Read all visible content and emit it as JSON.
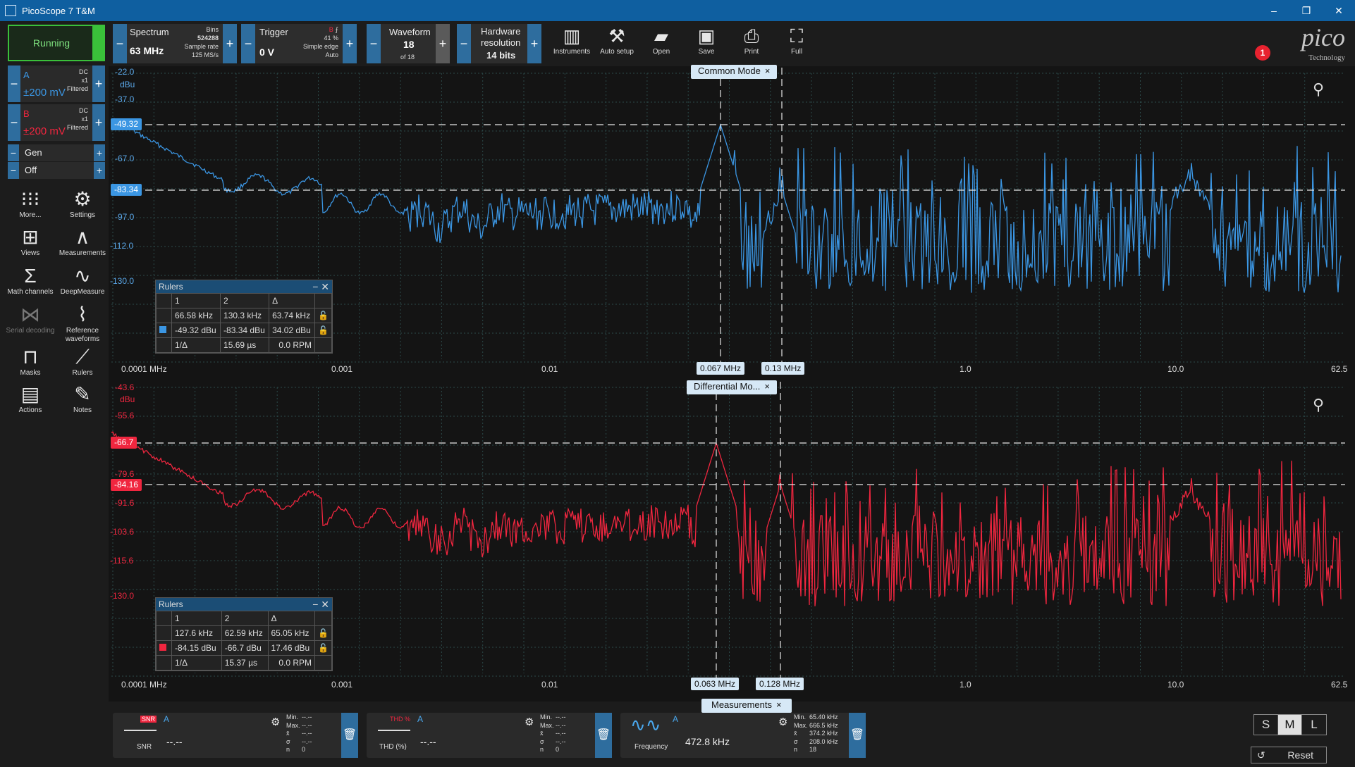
{
  "window": {
    "title": "PicoScope 7 T&M",
    "minimize": "–",
    "maximize": "❐",
    "close": "✕"
  },
  "toolbar": {
    "spectrum": {
      "label": "Spectrum",
      "value": "63 MHz",
      "bins_label": "Bins",
      "bins": "524288",
      "rate_label": "Sample rate",
      "rate": "125 MS/s"
    },
    "trigger": {
      "label": "Trigger",
      "value": "0 V",
      "channel": "B",
      "percent": "41 %",
      "type": "Simple edge",
      "mode": "Auto"
    },
    "waveform": {
      "label": "Waveform",
      "value": "18",
      "of": "of 18"
    },
    "hardware": {
      "label1": "Hardware",
      "label2": "resolution",
      "value": "14 bits"
    },
    "buttons": [
      {
        "label": "Instruments",
        "icon": "instruments-icon"
      },
      {
        "label": "Auto setup",
        "icon": "auto-setup-icon"
      },
      {
        "label": "Open",
        "icon": "folder-icon"
      },
      {
        "label": "Save",
        "icon": "save-icon"
      },
      {
        "label": "Print",
        "icon": "print-icon"
      },
      {
        "label": "Full",
        "icon": "fullscreen-icon"
      }
    ],
    "logo_text": "pico",
    "logo_sub": "Technology",
    "notification_count": "1"
  },
  "sidebar": {
    "run_state": "Running",
    "channel_a": {
      "name": "A",
      "range": "±200 mV",
      "coupling": "DC",
      "probe": "x1",
      "filter": "Filtered",
      "color": "#3b96e3"
    },
    "channel_b": {
      "name": "B",
      "range": "±200 mV",
      "coupling": "DC",
      "probe": "x1",
      "filter": "Filtered",
      "color": "#f0263f"
    },
    "gen": "Gen",
    "gen_state": "Off",
    "tools": [
      {
        "label": "More...",
        "icon": "more-icon"
      },
      {
        "label": "Settings",
        "icon": "gear-icon"
      },
      {
        "label": "Views",
        "icon": "views-icon"
      },
      {
        "label": "Measurements",
        "icon": "measurements-icon"
      },
      {
        "label": "Math channels",
        "icon": "sigma-icon"
      },
      {
        "label": "DeepMeasure",
        "icon": "deepmeasure-icon"
      },
      {
        "label": "Serial decoding",
        "icon": "serial-decoding-icon"
      },
      {
        "label": "Reference waveforms",
        "icon": "reference-waveforms-icon"
      },
      {
        "label": "Masks",
        "icon": "masks-icon"
      },
      {
        "label": "Rulers",
        "icon": "rulers-icon"
      },
      {
        "label": "Actions",
        "icon": "actions-icon"
      },
      {
        "label": "Notes",
        "icon": "notes-icon"
      }
    ]
  },
  "views": [
    {
      "tab": "Common Mode",
      "unit": "dBu",
      "y_ticks": [
        "-22.0",
        "-37.0",
        "-67.0",
        "-97.0",
        "-112.0",
        "-130.0"
      ],
      "y_flags": [
        "-49.32",
        "-83.34"
      ],
      "x_ticks": [
        "0.0001 MHz",
        "0.001",
        "0.01",
        "1.0",
        "10.0",
        "62.5"
      ],
      "x_flags": [
        "0.067 MHz",
        "0.13 MHz"
      ],
      "rulers": {
        "title": "Rulers",
        "cols": [
          "1",
          "2",
          "Δ"
        ],
        "freq": [
          "66.58 kHz",
          "130.3 kHz",
          "63.74 kHz"
        ],
        "level": [
          "-49.32 dBu",
          "-83.34 dBu",
          "34.02 dBu"
        ],
        "inv_label": "1/Δ",
        "inv": "15.69 µs",
        "rpm": "0.0 RPM"
      }
    },
    {
      "tab": "Differential Mo...",
      "unit": "dBu",
      "y_ticks": [
        "-43.6",
        "-55.6",
        "-79.6",
        "-91.6",
        "-103.6",
        "-115.6",
        "-130.0"
      ],
      "y_flags": [
        "-66.7",
        "-84.16"
      ],
      "x_ticks": [
        "0.0001 MHz",
        "0.001",
        "0.01",
        "1.0",
        "10.0",
        "62.5"
      ],
      "x_flags": [
        "0.063 MHz",
        "0.128 MHz"
      ],
      "rulers": {
        "title": "Rulers",
        "cols": [
          "1",
          "2",
          "Δ"
        ],
        "freq": [
          "127.6 kHz",
          "62.59 kHz",
          "65.05 kHz"
        ],
        "level": [
          "-84.15 dBu",
          "-66.7 dBu",
          "17.46 dBu"
        ],
        "inv_label": "1/Δ",
        "inv": "15.37 µs",
        "rpm": "0.0 RPM"
      }
    }
  ],
  "measurements": {
    "tab": "Measurements",
    "cards": [
      {
        "name": "SNR",
        "channel": "A",
        "value": "--.--",
        "icon_tag": "SNR",
        "min": "--.--",
        "max": "--.--",
        "mean": "--.--",
        "sigma": "--.--",
        "n": "0"
      },
      {
        "name": "THD (%)",
        "channel": "A",
        "value": "--.--",
        "icon_tag": "THD %",
        "min": "--.--",
        "max": "--.--",
        "mean": "--.--",
        "sigma": "--.--",
        "n": "0"
      },
      {
        "name": "Frequency",
        "channel": "A",
        "value": "472.8 kHz",
        "icon_tag": "",
        "min": "65.40 kHz",
        "max": "666.5 kHz",
        "mean": "374.2 kHz",
        "sigma": "208.0 kHz",
        "n": "18"
      }
    ],
    "stat_labels": {
      "min": "Min.",
      "max": "Max.",
      "mean": "x̄",
      "sigma": "σ",
      "n": "n"
    },
    "sizes": [
      "S",
      "M",
      "L"
    ],
    "selected_size": "M",
    "reset": "Reset"
  }
}
